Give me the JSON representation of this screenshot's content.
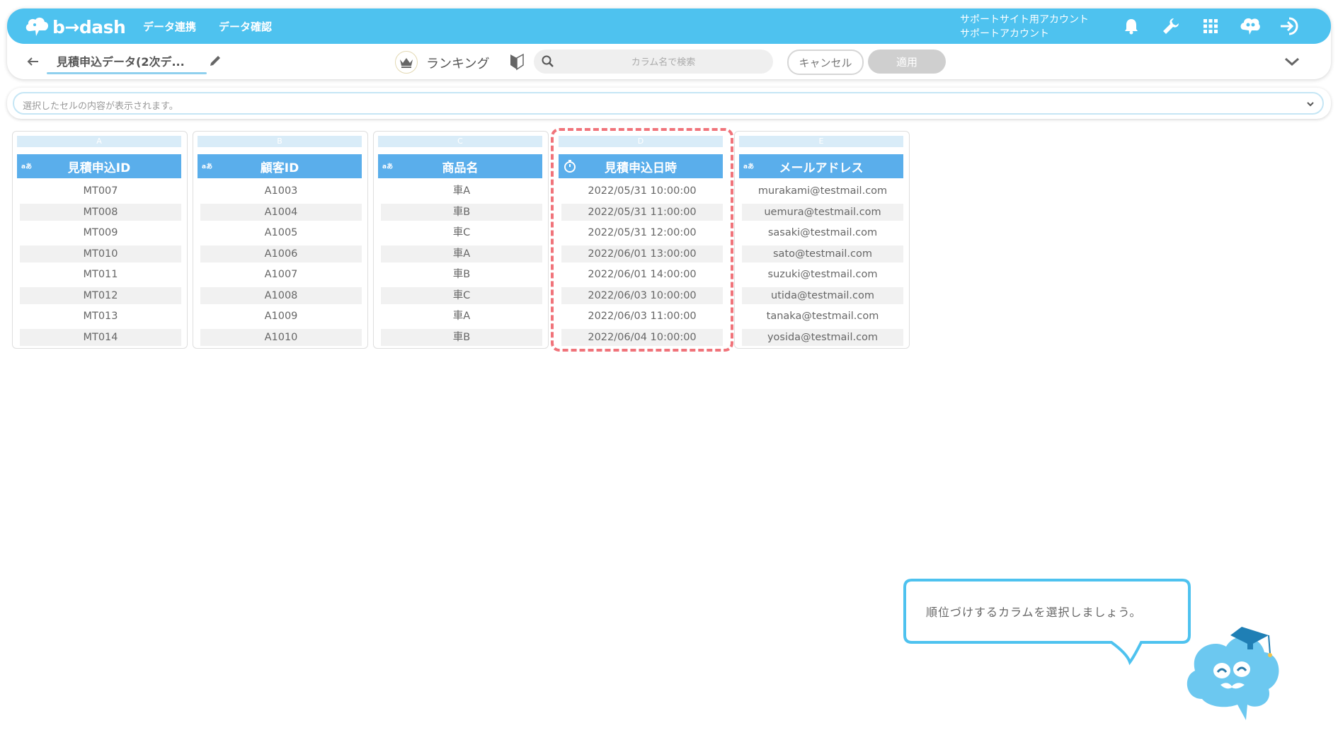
{
  "header": {
    "logo_text": "b→dash",
    "nav": [
      "データ連携",
      "データ確認"
    ],
    "account_line1": "サポートサイト用アカウント",
    "account_line2": "サポートアカウント"
  },
  "toolbar": {
    "title": "見積申込データ(2次デ...",
    "ranking_label": "ランキング",
    "search_placeholder": "カラム名で検索",
    "cancel_label": "キャンセル",
    "apply_label": "適用"
  },
  "cellbar": {
    "placeholder": "選択したセルの内容が表示されます。"
  },
  "columns": [
    {
      "letter": "A",
      "type": "aあ",
      "name": "見積申込ID",
      "values": [
        "MT007",
        "MT008",
        "MT009",
        "MT010",
        "MT011",
        "MT012",
        "MT013",
        "MT014"
      ]
    },
    {
      "letter": "B",
      "type": "aあ",
      "name": "顧客ID",
      "values": [
        "A1003",
        "A1004",
        "A1005",
        "A1006",
        "A1007",
        "A1008",
        "A1009",
        "A1010"
      ]
    },
    {
      "letter": "C",
      "type": "aあ",
      "name": "商品名",
      "values": [
        "車A",
        "車B",
        "車C",
        "車A",
        "車B",
        "車C",
        "車A",
        "車B"
      ]
    },
    {
      "letter": "D",
      "type": "clock",
      "name": "見積申込日時",
      "values": [
        "2022/05/31 10:00:00",
        "2022/05/31 11:00:00",
        "2022/05/31 12:00:00",
        "2022/06/01 13:00:00",
        "2022/06/01 14:00:00",
        "2022/06/03 10:00:00",
        "2022/06/03 11:00:00",
        "2022/06/04 10:00:00"
      ]
    },
    {
      "letter": "E",
      "type": "aあ",
      "name": "メールアドレス",
      "values": [
        "murakami@testmail.com",
        "uemura@testmail.com",
        "sasaki@testmail.com",
        "sato@testmail.com",
        "suzuki@testmail.com",
        "utida@testmail.com",
        "tanaka@testmail.com",
        "yosida@testmail.com"
      ]
    }
  ],
  "tutorial": {
    "message": "順位づけするカラムを選択しましょう。"
  },
  "colors": {
    "brand": "#4ec2ef",
    "column_header": "#5aaeeb",
    "highlight": "#f0737a"
  }
}
